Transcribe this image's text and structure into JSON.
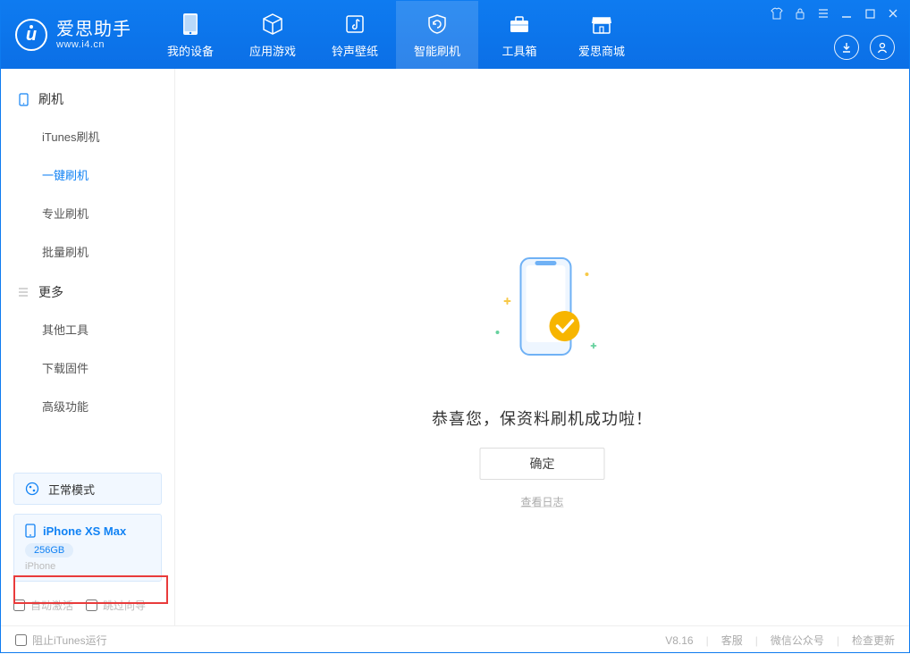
{
  "app": {
    "name": "爱思助手",
    "url": "www.i4.cn"
  },
  "nav": {
    "items": [
      {
        "label": "我的设备"
      },
      {
        "label": "应用游戏"
      },
      {
        "label": "铃声壁纸"
      },
      {
        "label": "智能刷机"
      },
      {
        "label": "工具箱"
      },
      {
        "label": "爱思商城"
      }
    ],
    "active_index": 3
  },
  "sidebar": {
    "sections": [
      {
        "title": "刷机",
        "items": [
          {
            "label": "iTunes刷机"
          },
          {
            "label": "一键刷机"
          },
          {
            "label": "专业刷机"
          },
          {
            "label": "批量刷机"
          }
        ],
        "active_index": 1
      },
      {
        "title": "更多",
        "items": [
          {
            "label": "其他工具"
          },
          {
            "label": "下载固件"
          },
          {
            "label": "高级功能"
          }
        ],
        "active_index": -1
      }
    ],
    "mode_label": "正常模式",
    "device": {
      "name": "iPhone XS Max",
      "storage": "256GB",
      "type": "iPhone"
    },
    "checks": {
      "auto_activate": "自动激活",
      "skip_guide": "跳过向导"
    }
  },
  "main": {
    "success_text": "恭喜您，保资料刷机成功啦！",
    "ok_label": "确定",
    "view_log": "查看日志"
  },
  "footer": {
    "block_itunes": "阻止iTunes运行",
    "version": "V8.16",
    "links": {
      "support": "客服",
      "wechat": "微信公众号",
      "update": "检查更新"
    }
  },
  "colors": {
    "primary": "#0e7bf0",
    "accent": "#1182f4",
    "highlight": "#e93b3b"
  }
}
